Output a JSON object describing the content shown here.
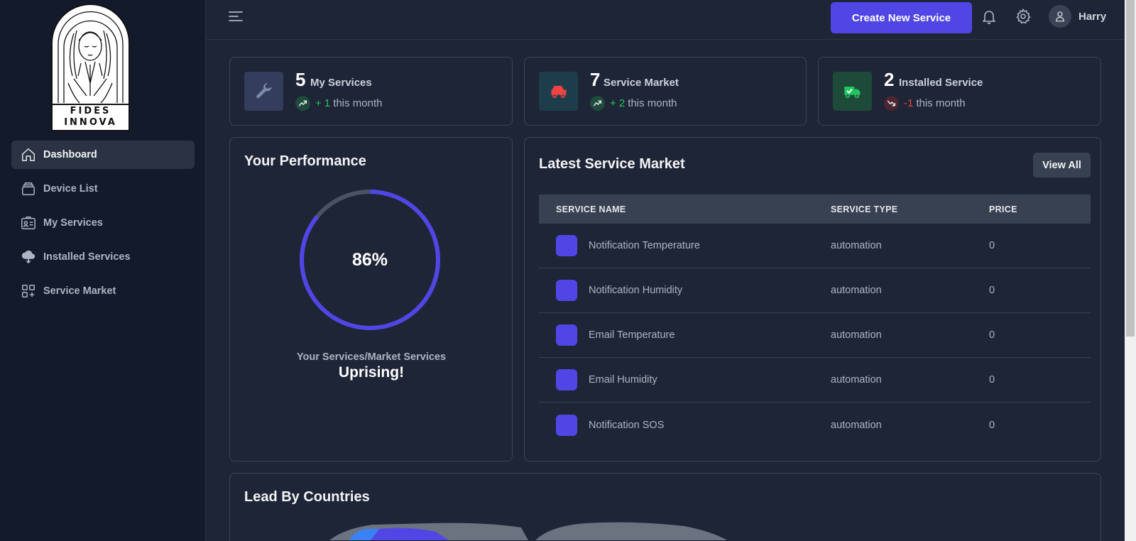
{
  "brand": {
    "line1": "FIDES",
    "line2": "INNOVA"
  },
  "sidebar": {
    "items": [
      {
        "label": "Dashboard",
        "icon": "home-icon",
        "active": true
      },
      {
        "label": "Device List",
        "icon": "layers-icon",
        "active": false
      },
      {
        "label": "My Services",
        "icon": "id-card-icon",
        "active": false
      },
      {
        "label": "Installed Services",
        "icon": "cloud-download-icon",
        "active": false
      },
      {
        "label": "Service Market",
        "icon": "grid-plus-icon",
        "active": false
      }
    ]
  },
  "header": {
    "create_label": "Create New Service",
    "user_name": "Harry"
  },
  "stats": [
    {
      "value": "5",
      "label": "My Services",
      "change": "+ 1",
      "suffix": "this month",
      "trend": "up",
      "icon": "wrench-icon"
    },
    {
      "value": "7",
      "label": "Service Market",
      "change": "+ 2",
      "suffix": "this month",
      "trend": "up",
      "icon": "car-icon"
    },
    {
      "value": "2",
      "label": "Installed Service",
      "change": "-1",
      "suffix": "this month",
      "trend": "down",
      "icon": "truck-check-icon"
    }
  ],
  "performance": {
    "title": "Your Performance",
    "percent_label": "86%",
    "percent": 86,
    "subtitle": "Your Services/Market Services",
    "status": "Uprising!"
  },
  "market": {
    "title": "Latest Service Market",
    "view_all": "View All",
    "columns": [
      "SERVICE NAME",
      "SERVICE TYPE",
      "PRICE"
    ],
    "rows": [
      {
        "name": "Notification Temperature",
        "type": "automation",
        "price": "0"
      },
      {
        "name": "Notification Humidity",
        "type": "automation",
        "price": "0"
      },
      {
        "name": "Email Temperature",
        "type": "automation",
        "price": "0"
      },
      {
        "name": "Email Humidity",
        "type": "automation",
        "price": "0"
      },
      {
        "name": "Notification SOS",
        "type": "automation",
        "price": "0"
      }
    ]
  },
  "countries": {
    "title": "Lead By Countries"
  },
  "colors": {
    "accent": "#4f46e5",
    "up": "#22c55e",
    "down": "#ef4444",
    "sidebar": "#131a2b",
    "background": "#1e2536"
  }
}
